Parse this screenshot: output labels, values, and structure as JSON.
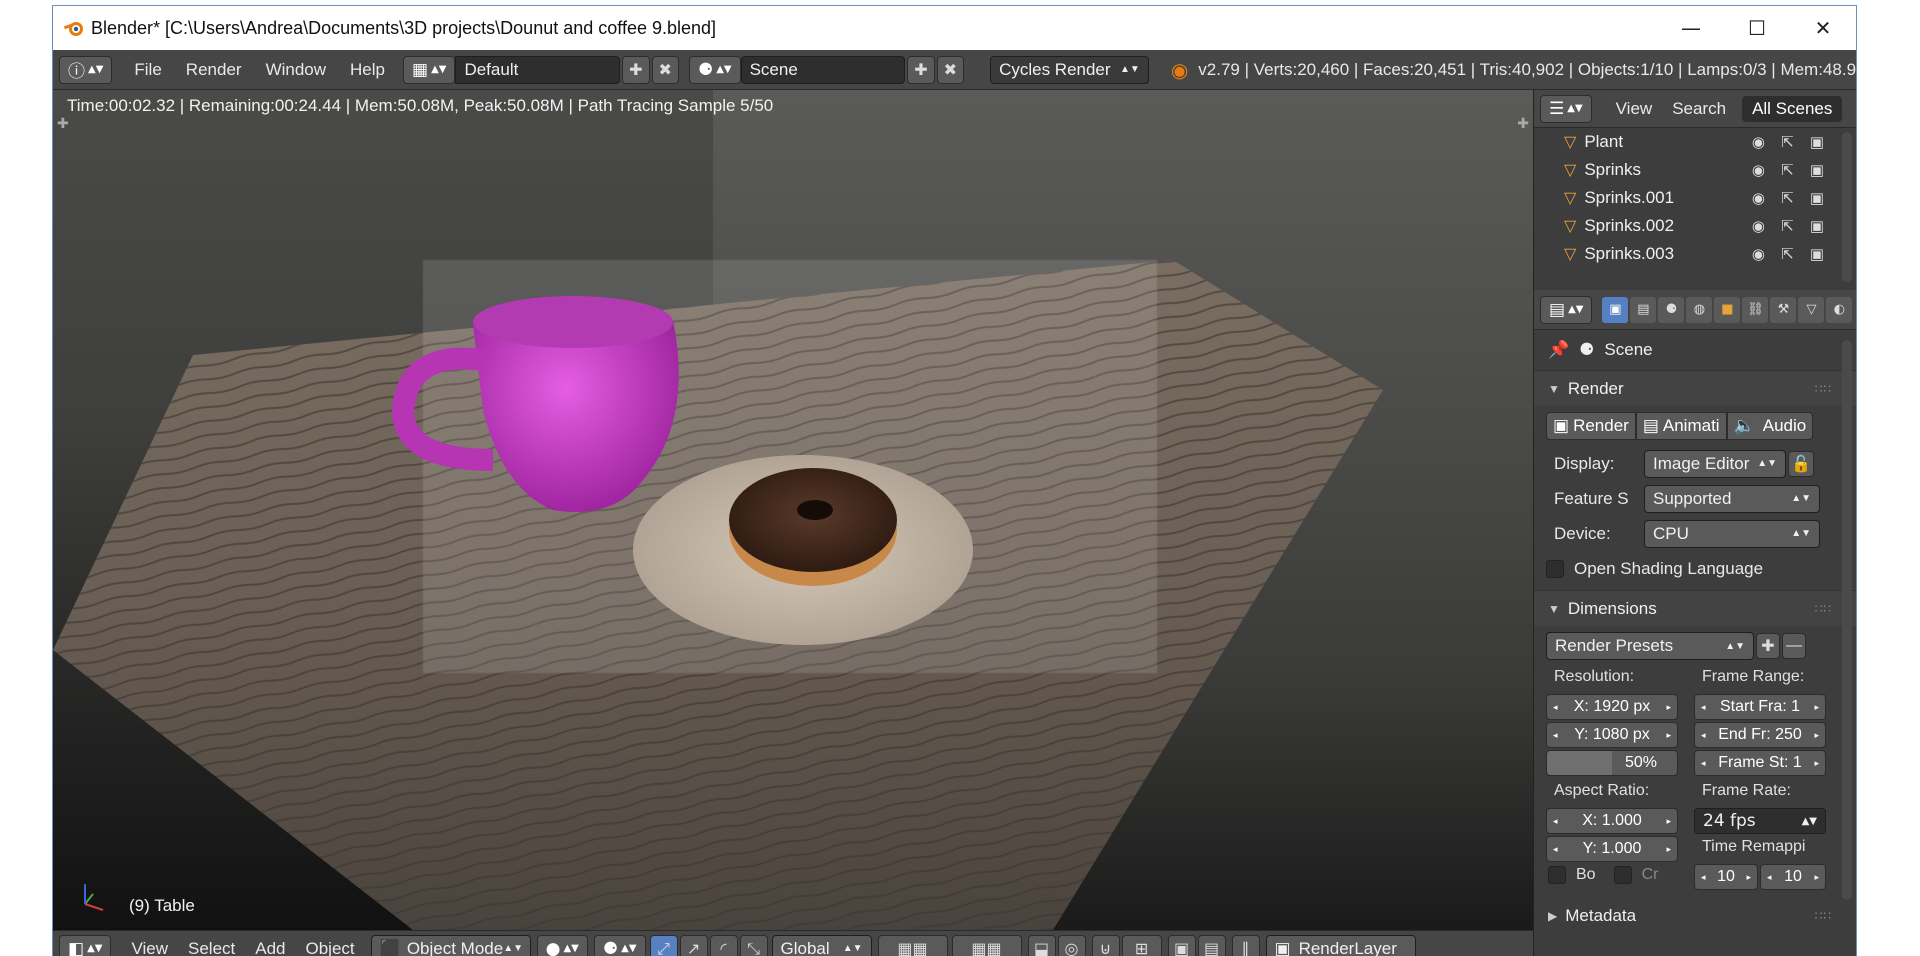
{
  "window": {
    "title": "Blender* [C:\\Users\\Andrea\\Documents\\3D projects\\Dounut and coffee 9.blend]",
    "controls": {
      "minimize": "—",
      "maximize": "☐",
      "close": "✕"
    }
  },
  "info_header": {
    "menus": [
      "File",
      "Render",
      "Window",
      "Help"
    ],
    "layout_name": "Default",
    "scene_name": "Scene",
    "engine": "Cycles Render",
    "stats": "v2.79 | Verts:20,460 | Faces:20,451 | Tris:40,902 | Objects:1/10 | Lamps:0/3 | Mem:48.9"
  },
  "viewport": {
    "render_info": "Time:00:02.32 | Remaining:00:24.44 | Mem:50.08M, Peak:50.08M | Path Tracing Sample 5/50",
    "object_label": "(9) Table"
  },
  "viewport_footer": {
    "menus": [
      "View",
      "Select",
      "Add",
      "Object"
    ],
    "mode": "Object Mode",
    "orientation": "Global",
    "render_layer": "RenderLayer"
  },
  "outliner": {
    "menus": [
      "View",
      "Search"
    ],
    "filter": "All Scenes",
    "items": [
      "Plant",
      "Sprinks",
      "Sprinks.001",
      "Sprinks.002",
      "Sprinks.003"
    ]
  },
  "properties": {
    "scene_label": "Scene",
    "render_panel": {
      "title": "Render",
      "buttons": [
        "Render",
        "Animati",
        "Audio"
      ],
      "display_label": "Display:",
      "display_value": "Image Editor",
      "feature_label": "Feature S",
      "feature_value": "Supported",
      "device_label": "Device:",
      "device_value": "CPU",
      "osl_label": "Open Shading Language"
    },
    "dimensions_panel": {
      "title": "Dimensions",
      "presets": "Render Presets",
      "resolution_label": "Resolution:",
      "res_x": "X:  1920 px",
      "res_y": "Y:  1080 px",
      "res_pct": "50%",
      "frame_range_label": "Frame Range:",
      "start": "Start Fra:  1",
      "end": "End Fr: 250",
      "step": "Frame St: 1",
      "aspect_label": "Aspect Ratio:",
      "aspect_x": "X:      1.000",
      "aspect_y": "Y:      1.000",
      "frame_rate_label": "Frame Rate:",
      "fps": "24 fps",
      "remap_label": "Time Remappi",
      "remap_old": "10",
      "remap_new": "10",
      "border": "Bo",
      "crop": "Cr"
    },
    "metadata_title": "Metadata"
  }
}
